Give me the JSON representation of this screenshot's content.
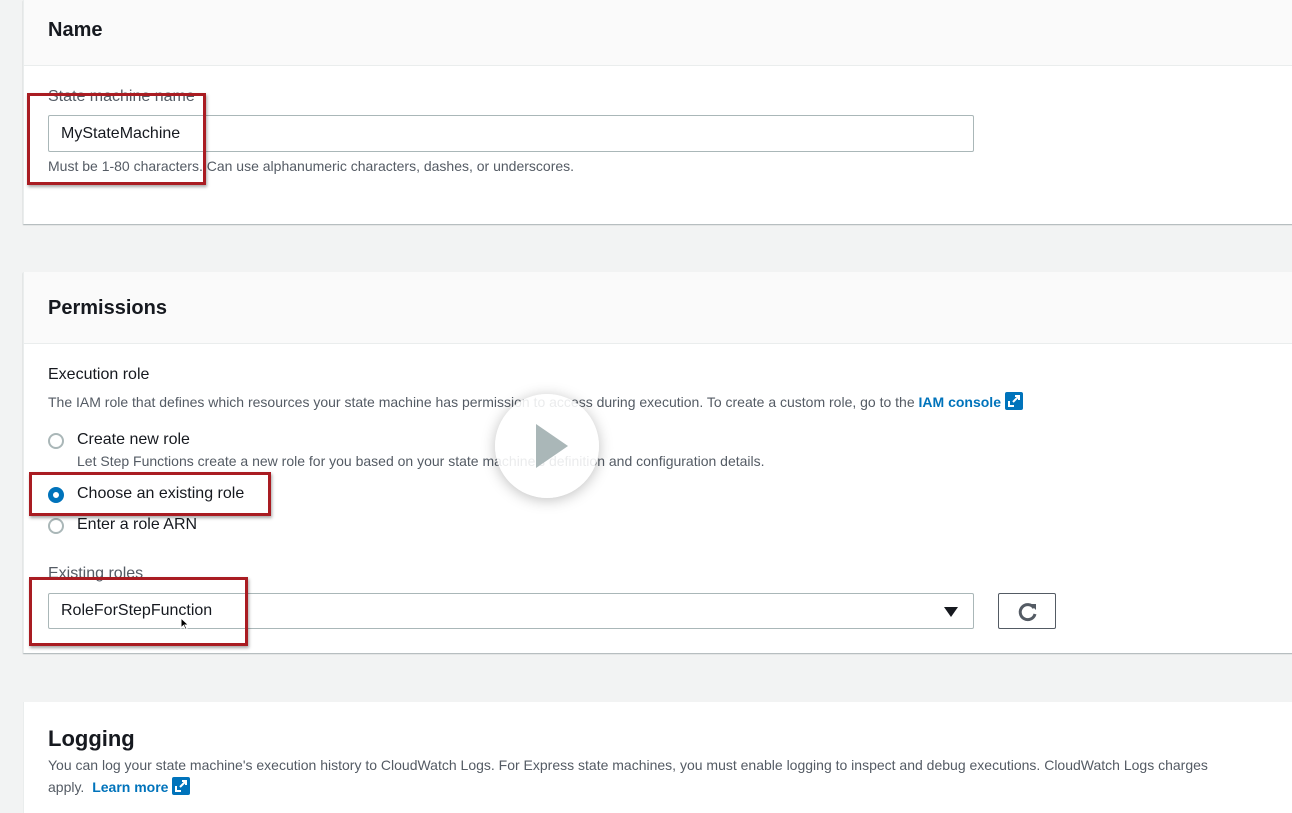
{
  "name_section": {
    "title": "Name",
    "field_label": "State machine name",
    "field_value": "MyStateMachine",
    "field_hint": "Must be 1-80 characters. Can use alphanumeric characters, dashes, or underscores."
  },
  "permissions_section": {
    "title": "Permissions",
    "role_label": "Execution role",
    "role_desc_prefix": "The IAM role that defines which resources your state machine has permission to access during execution. To create a custom role, go to the",
    "role_desc_link": "IAM console",
    "options": [
      {
        "label": "Create new role",
        "desc": "Let Step Functions create a new role for you based on your state machine's definition and configuration details.",
        "checked": false
      },
      {
        "label": "Choose an existing role",
        "checked": true
      },
      {
        "label": "Enter a role ARN",
        "checked": false
      }
    ],
    "existing_label": "Existing roles",
    "existing_value": "RoleForStepFunction"
  },
  "logging_section": {
    "title": "Logging",
    "desc_line1": "You can log your state machine's execution history to CloudWatch Logs. For Express state machines, you must enable logging to inspect and debug executions. CloudWatch Logs charges",
    "desc_line2": "apply.",
    "link": "Learn more"
  },
  "icons": {
    "external_link": "external-link-icon",
    "refresh": "refresh-icon",
    "caret": "caret-down-icon",
    "play": "play-icon",
    "cursor": "mouse-cursor-icon"
  },
  "colors": {
    "link": "#0073bb",
    "highlight": "#a91c22",
    "background": "#f2f3f3"
  }
}
